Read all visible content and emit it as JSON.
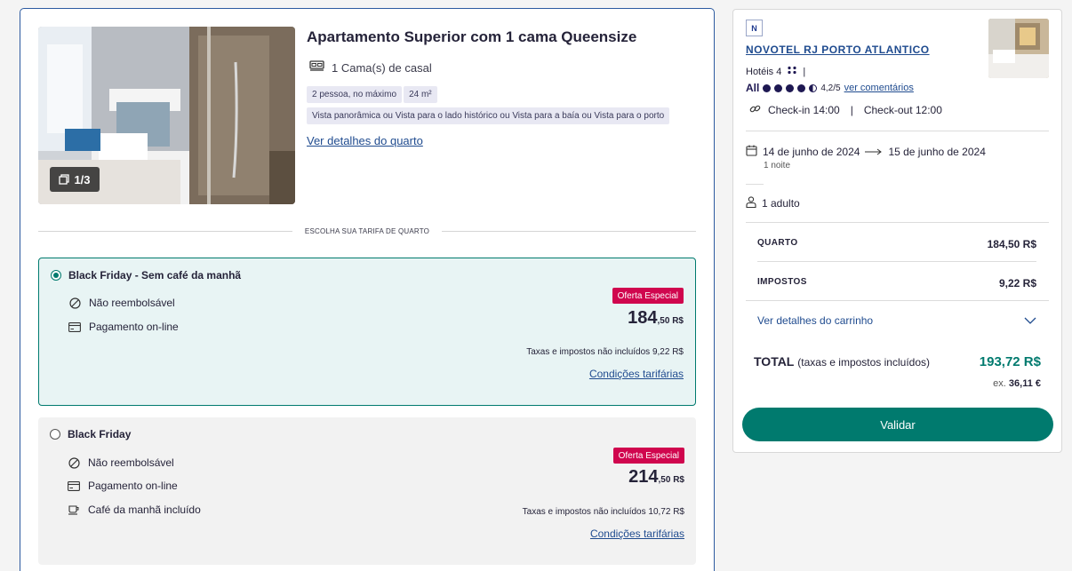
{
  "room": {
    "title": "Apartamento Superior com 1 cama Queensize",
    "bed": "1 Cama(s) de casal",
    "tags": [
      "2 pessoa, no máximo",
      "24 m²",
      "Vista panorâmica ou Vista para o lado histórico ou Vista para a baía ou Vista para o porto"
    ],
    "details_link": "Ver detalhes do quarto",
    "photo_counter": "1/3",
    "rate_section_label": "ESCOLHA SUA TARIFA DE QUARTO"
  },
  "rates": [
    {
      "name": "Black Friday - Sem café da manhã",
      "selected": true,
      "features": [
        "Não reembolsável",
        "Pagamento on-line"
      ],
      "badge": "Oferta Especial",
      "price_main": "184",
      "price_cents": ",50 R$",
      "tax_note": "Taxas e impostos não incluídos 9,22 R$",
      "conditions": "Condições tarifárias"
    },
    {
      "name": "Black Friday",
      "selected": false,
      "features": [
        "Não reembolsável",
        "Pagamento on-line",
        "Café da manhã incluído"
      ],
      "badge": "Oferta Especial",
      "price_main": "214",
      "price_cents": ",50 R$",
      "tax_note": "Taxas e impostos não incluídos 10,72 R$",
      "conditions": "Condições tarifárias"
    }
  ],
  "summary": {
    "logo": "N",
    "hotel_name": "NOVOTEL RJ PORTO ATLANTICO",
    "category": "Hotéis 4",
    "rating_brand": "All",
    "rating_score": "4,2/5",
    "rating_link": "ver comentários",
    "checkin": "Check-in 14:00",
    "checkout": "Check-out 12:00",
    "date_from": "14 de junho de 2024",
    "date_to": "15 de junho de 2024",
    "nights": "1 noite",
    "guests": "1 adulto",
    "room_label": "QUARTO",
    "room_value": "184,50 R$",
    "tax_label": "IMPOSTOS",
    "tax_value": "9,22 R$",
    "cart_link": "Ver detalhes do carrinho",
    "total_label": "TOTAL",
    "total_sub": "(taxas e impostos incluídos)",
    "total_value": "193,72 R$",
    "ex_label": "ex.",
    "ex_value": "36,11 €",
    "validate_button": "Validar"
  },
  "colors": {
    "accent": "#007a6e",
    "link": "#1f4b8f",
    "badge": "#d0064e",
    "brand_dark": "#1e1852"
  }
}
